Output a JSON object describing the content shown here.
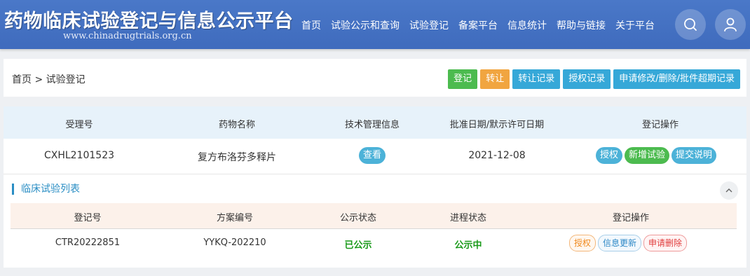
{
  "header": {
    "title": "药物临床试验登记与信息公示平台",
    "subtitle": "www.chinadrugtrials.org.cn",
    "nav": [
      "首页",
      "试验公示和查询",
      "试验登记",
      "备案平台",
      "信息统计",
      "帮助与链接",
      "关于平台"
    ],
    "search_icon": "search-icon",
    "user_icon": "user-icon"
  },
  "breadcrumb": {
    "home": "首页",
    "separator": ">",
    "current": "试验登记"
  },
  "actions": {
    "register": "登记",
    "transfer": "转让",
    "transfer_record": "转让记录",
    "authorize_record": "授权记录",
    "modify_record": "申请修改/删除/批件超期记录"
  },
  "table": {
    "headers": [
      "受理号",
      "药物名称",
      "技术管理信息",
      "批准日期/默示许可日期",
      "登记操作"
    ],
    "row": {
      "accept_no": "CXHL2101523",
      "drug_name": "复方布洛芬多释片",
      "view_label": "查看",
      "date": "2021-12-08",
      "ops": [
        "授权",
        "新增试验",
        "提交说明"
      ]
    }
  },
  "trials": {
    "section_title": "临床试验列表",
    "headers": [
      "登记号",
      "方案编号",
      "公示状态",
      "进程状态",
      "登记操作"
    ],
    "row": {
      "reg_no": "CTR20222851",
      "protocol_no": "YYKQ-202210",
      "publish_status": "已公示",
      "progress_status": "公示中",
      "ops": [
        "授权",
        "信息更新",
        "申请删除"
      ]
    }
  },
  "colors": {
    "header_bg": "#4a78c8",
    "green": "#4cbb4f",
    "orange": "#f1a540",
    "blue": "#36a8d8",
    "status_green": "#1a9a1a"
  }
}
